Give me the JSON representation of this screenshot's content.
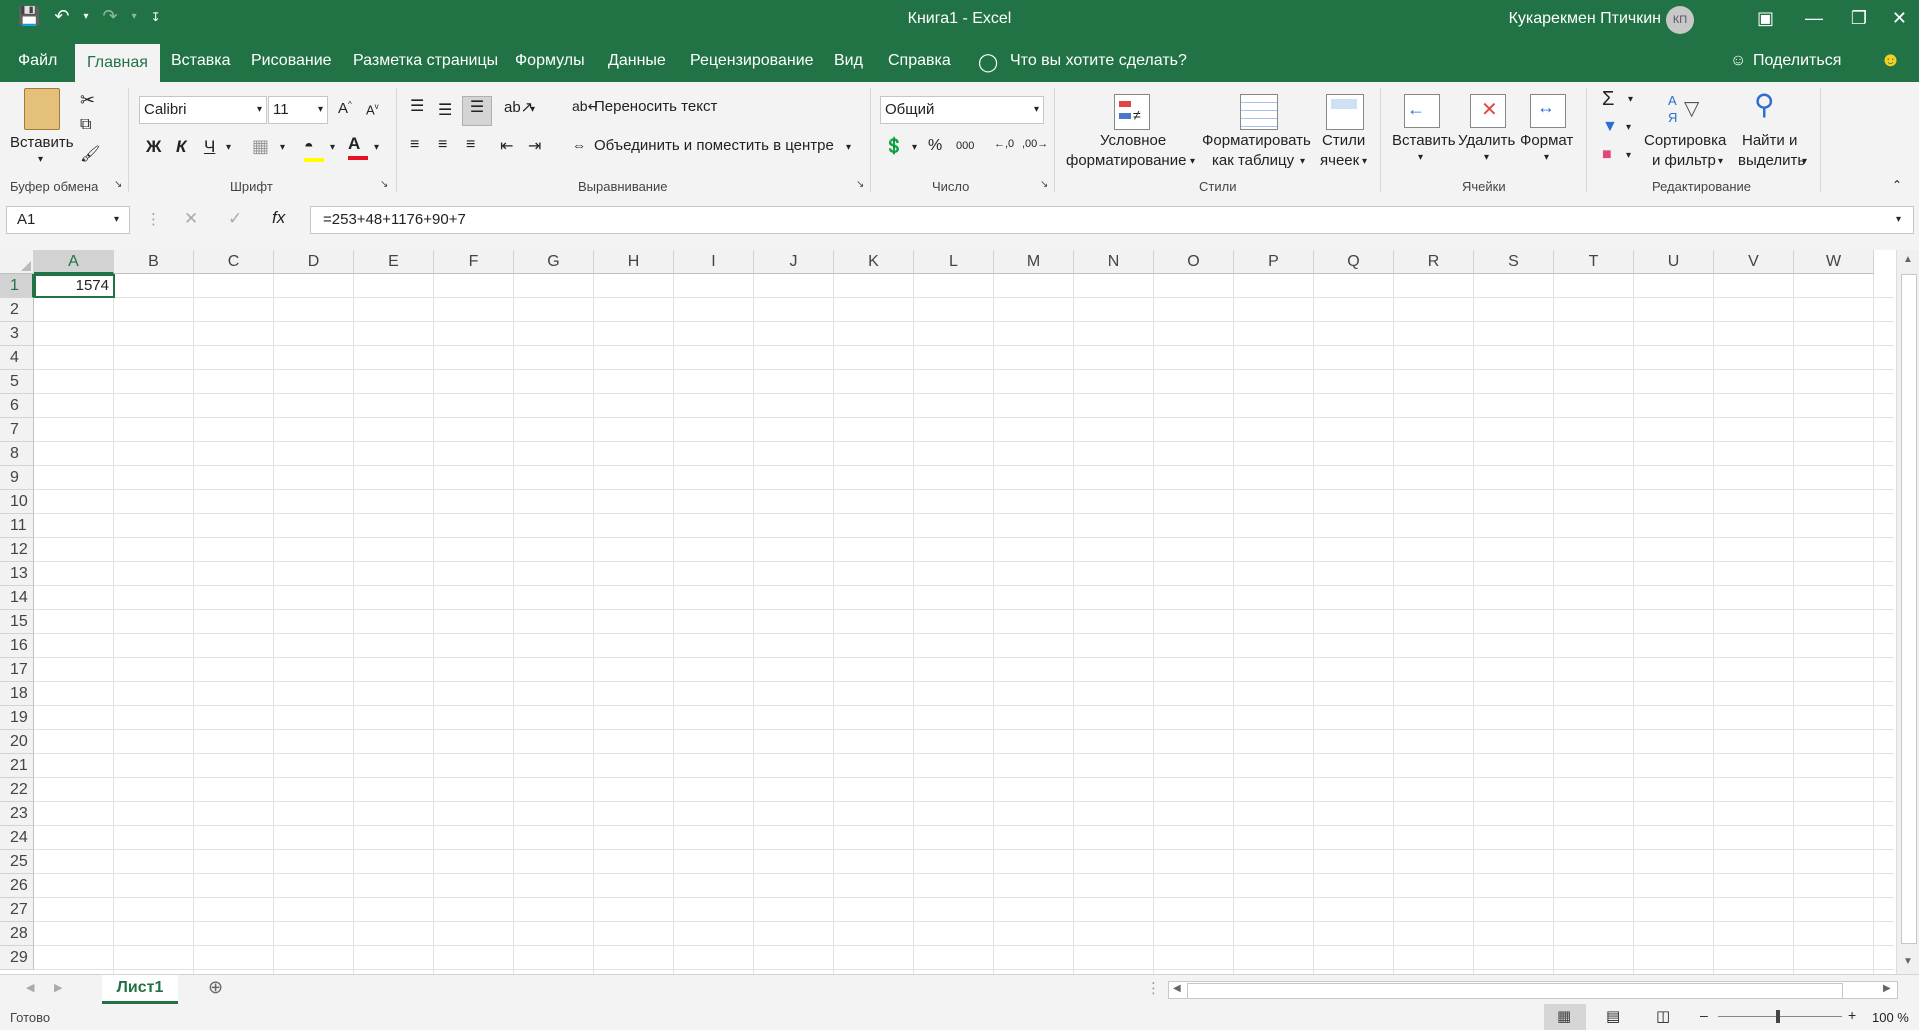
{
  "titlebar": {
    "title": "Книга1  -  Excel",
    "user": "Кукарекмен Птичкин",
    "avatar_initials": "КП"
  },
  "tabs": [
    {
      "label": "Файл"
    },
    {
      "label": "Главная"
    },
    {
      "label": "Вставка"
    },
    {
      "label": "Рисование"
    },
    {
      "label": "Разметка страницы"
    },
    {
      "label": "Формулы"
    },
    {
      "label": "Данные"
    },
    {
      "label": "Рецензирование"
    },
    {
      "label": "Вид"
    },
    {
      "label": "Справка"
    }
  ],
  "search_hint": "Что вы хотите сделать?",
  "share_label": "Поделиться",
  "ribbon": {
    "paste": "Вставить",
    "clipboard_group": "Буфер обмена",
    "font_name": "Calibri",
    "font_size": "11",
    "bold": "Ж",
    "italic": "К",
    "underline": "Ч",
    "font_group": "Шрифт",
    "wrap_text": "Переносить текст",
    "merge_center": "Объединить и поместить в центре",
    "alignment_group": "Выравнивание",
    "number_format": "Общий",
    "percent": "%",
    "thousands": "000",
    "number_group": "Число",
    "conditional_1": "Условное",
    "conditional_2": "форматирование",
    "format_table_1": "Форматировать",
    "format_table_2": "как таблицу",
    "cell_styles_1": "Стили",
    "cell_styles_2": "ячеек",
    "styles_group": "Стили",
    "insert": "Вставить",
    "delete": "Удалить",
    "format": "Формат",
    "cells_group": "Ячейки",
    "sort_1": "Сортировка",
    "sort_2": "и фильтр",
    "find_1": "Найти и",
    "find_2": "выделить",
    "editing_group": "Редактирование"
  },
  "formula_bar": {
    "name_box": "A1",
    "fx": "fx",
    "formula": "=253+48+1176+90+7"
  },
  "columns": [
    "A",
    "B",
    "C",
    "D",
    "E",
    "F",
    "G",
    "H",
    "I",
    "J",
    "K",
    "L",
    "M",
    "N",
    "O",
    "P",
    "Q",
    "R",
    "S",
    "T",
    "U",
    "V",
    "W"
  ],
  "rows": [
    "1",
    "2",
    "3",
    "4",
    "5",
    "6",
    "7",
    "8",
    "9",
    "10",
    "11",
    "12",
    "13",
    "14",
    "15",
    "16",
    "17",
    "18",
    "19",
    "20",
    "21",
    "22",
    "23",
    "24",
    "25",
    "26",
    "27",
    "28",
    "29"
  ],
  "cells": {
    "A1": "1574"
  },
  "sheet_tab": "Лист1",
  "status": {
    "ready": "Готово",
    "zoom": "100 %"
  },
  "colors": {
    "accent": "#217346"
  }
}
